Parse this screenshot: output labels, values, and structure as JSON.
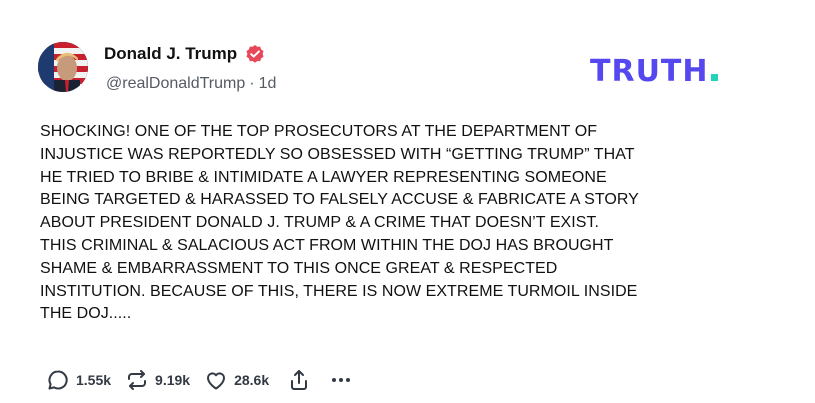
{
  "author": {
    "display_name": "Donald J. Trump",
    "handle": "@realDonaldTrump",
    "separator": "·",
    "time_ago": "1d",
    "verified": true
  },
  "brand": {
    "logo_text": "TRUTH",
    "logo_color": "#5448ee",
    "logo_dot_color": "#22d3b7"
  },
  "post": {
    "text": "SHOCKING! ONE OF THE TOP PROSECUTORS AT THE DEPARTMENT OF\nINJUSTICE WAS REPORTEDLY SO OBSESSED WITH “GETTING TRUMP” THAT\nHE TRIED TO BRIBE & INTIMIDATE A LAWYER REPRESENTING SOMEONE\nBEING TARGETED & HARASSED TO FALSELY ACCUSE & FABRICATE A STORY\nABOUT PRESIDENT DONALD J. TRUMP & A CRIME THAT DOESN’T EXIST.\nTHIS CRIMINAL & SALACIOUS ACT FROM WITHIN THE DOJ HAS BROUGHT\nSHAME & EMBARRASSMENT TO THIS ONCE GREAT & RESPECTED\nINSTITUTION. BECAUSE OF THIS, THERE IS NOW EXTREME TURMOIL INSIDE\nTHE DOJ....."
  },
  "actions": {
    "replies": "1.55k",
    "retruths": "9.19k",
    "likes": "28.6k",
    "reply_icon": "speech-bubble-icon",
    "retruth_icon": "repost-arrows-icon",
    "like_icon": "heart-icon",
    "share_icon": "share-icon",
    "more_icon": "more-dots-icon"
  },
  "colors": {
    "verified_badge": "#e8475a",
    "action_text": "#333a44",
    "muted": "#555a64"
  }
}
